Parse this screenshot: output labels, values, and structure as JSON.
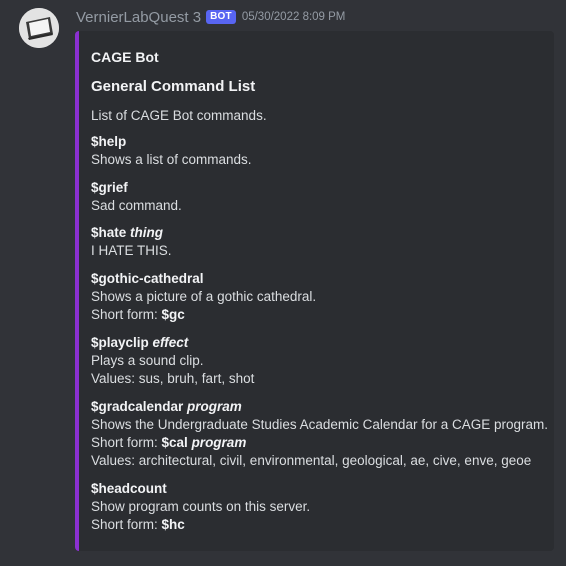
{
  "message": {
    "username": "VernierLabQuest 3",
    "bot_tag": "BOT",
    "timestamp": "05/30/2022 8:09 PM",
    "accent_color": "#8b30d1"
  },
  "embed": {
    "author": "CAGE Bot",
    "title": "General Command List",
    "description": "List of CAGE Bot commands.",
    "fields": [
      {
        "cmd": "$help",
        "arg": "",
        "lines": [
          "Shows a list of commands."
        ]
      },
      {
        "cmd": "$grief",
        "arg": "",
        "lines": [
          "Sad command."
        ]
      },
      {
        "cmd": "$hate ",
        "arg": "thing",
        "lines": [
          "I HATE THIS."
        ]
      },
      {
        "cmd": "$gothic-cathedral",
        "arg": "",
        "lines": [
          "Shows a picture of a gothic cathedral."
        ],
        "short_prefix": "Short form: ",
        "short_cmd": "$gc",
        "short_arg": ""
      },
      {
        "cmd": "$playclip ",
        "arg": "effect",
        "lines": [
          "Plays a sound clip.",
          "Values: sus, bruh, fart, shot"
        ]
      },
      {
        "cmd": "$gradcalendar ",
        "arg": "program",
        "lines": [
          "Shows the Undergraduate Studies Academic Calendar for a CAGE program."
        ],
        "short_prefix": "Short form: ",
        "short_cmd": "$cal ",
        "short_arg": "program",
        "extra": "Values: architectural, civil, environmental, geological, ae, cive, enve, geoe"
      },
      {
        "cmd": "$headcount",
        "arg": "",
        "lines": [
          "Show program counts on this server."
        ],
        "short_prefix": "Short form: ",
        "short_cmd": "$hc",
        "short_arg": ""
      }
    ]
  }
}
